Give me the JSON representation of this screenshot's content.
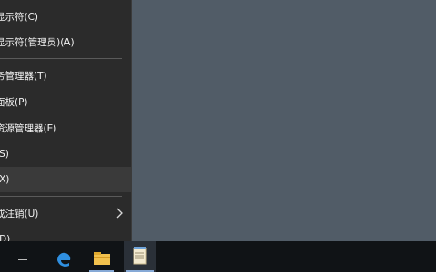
{
  "menu": {
    "items": [
      {
        "label": "显示符(C)"
      },
      {
        "label": "显示符(管理员)(A)"
      },
      {
        "label": "务管理器(T)"
      },
      {
        "label": "面板(P)"
      },
      {
        "label": "资源管理器(E)"
      },
      {
        "label": "(S)"
      },
      {
        "label": "(X)"
      },
      {
        "label": "或注销(U)"
      },
      {
        "label": "(D)"
      }
    ]
  },
  "taskbar": {
    "items": [
      {
        "icon": "edge-browser-icon"
      },
      {
        "icon": "file-explorer-icon"
      },
      {
        "icon": "notepad-icon"
      }
    ]
  },
  "colors": {
    "desktop": "#515c67",
    "menu_bg": "#2b2b2b",
    "taskbar_bg": "#101316",
    "accent": "#86a9d6"
  }
}
